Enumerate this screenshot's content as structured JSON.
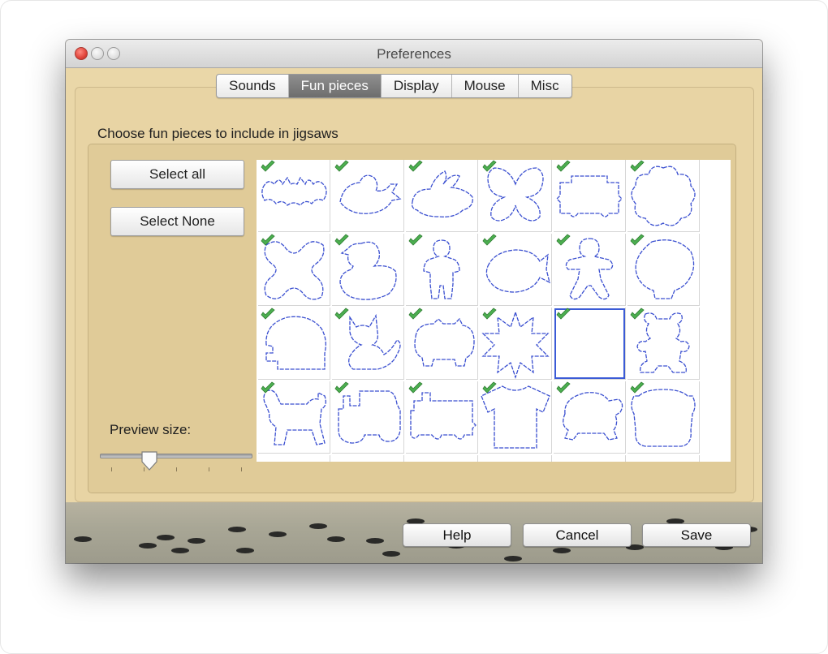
{
  "window": {
    "title": "Preferences"
  },
  "tabs": [
    {
      "label": "Sounds",
      "active": false
    },
    {
      "label": "Fun pieces",
      "active": true
    },
    {
      "label": "Display",
      "active": false
    },
    {
      "label": "Mouse",
      "active": false
    },
    {
      "label": "Misc",
      "active": false
    }
  ],
  "fun_pieces": {
    "heading": "Choose fun pieces to include in jigsaws",
    "select_all_label": "Select all",
    "select_none_label": "Select None",
    "preview_size_label": "Preview size:",
    "preview_size_level": 0.33,
    "pieces": [
      {
        "name": "bat",
        "checked": true
      },
      {
        "name": "bird",
        "checked": true
      },
      {
        "name": "rabbit",
        "checked": true
      },
      {
        "name": "butterfly",
        "checked": true
      },
      {
        "name": "train-car",
        "checked": true
      },
      {
        "name": "flower",
        "checked": true
      },
      {
        "name": "x-shape",
        "checked": true
      },
      {
        "name": "duck",
        "checked": true
      },
      {
        "name": "teddy-person",
        "checked": true
      },
      {
        "name": "fish",
        "checked": true
      },
      {
        "name": "gingerbread-man",
        "checked": true
      },
      {
        "name": "head",
        "checked": true
      },
      {
        "name": "helmet",
        "checked": true
      },
      {
        "name": "cat",
        "checked": true
      },
      {
        "name": "pig",
        "checked": true
      },
      {
        "name": "star-burst",
        "checked": true
      },
      {
        "name": "square",
        "checked": true,
        "selected": true
      },
      {
        "name": "teddy-bear",
        "checked": true
      },
      {
        "name": "dog",
        "checked": true
      },
      {
        "name": "tractor",
        "checked": true
      },
      {
        "name": "locomotive",
        "checked": true
      },
      {
        "name": "t-shirt",
        "checked": true
      },
      {
        "name": "turtle",
        "checked": true
      },
      {
        "name": "pot",
        "checked": true
      }
    ]
  },
  "footer": {
    "help_label": "Help",
    "cancel_label": "Cancel",
    "save_label": "Save"
  },
  "colors": {
    "window_background": "#ead7a8",
    "active_tab": "#7a7a7a",
    "piece_outline": "#3a4fd0",
    "checkmark": "#4caf50"
  }
}
